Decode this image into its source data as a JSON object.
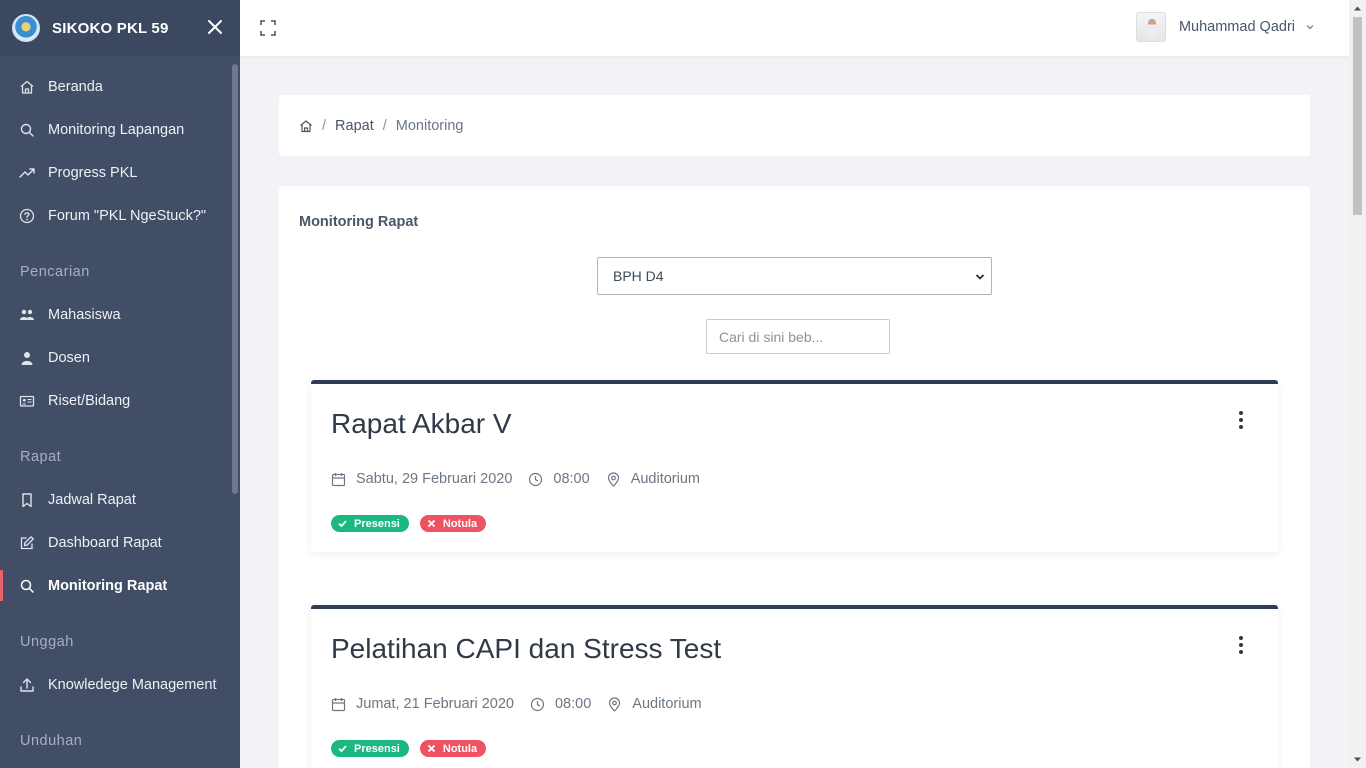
{
  "app": {
    "title": "SIKOKO PKL 59"
  },
  "sidebar": {
    "items": [
      {
        "label": "Beranda",
        "icon": "home-icon"
      },
      {
        "label": "Monitoring Lapangan",
        "icon": "search-icon"
      },
      {
        "label": "Progress PKL",
        "icon": "trending-up-icon"
      },
      {
        "label": "Forum \"PKL NgeStuck?\"",
        "icon": "help-circle-icon"
      }
    ],
    "section_pencarian": "Pencarian",
    "pencarian_items": [
      {
        "label": "Mahasiswa",
        "icon": "users-icon"
      },
      {
        "label": "Dosen",
        "icon": "user-icon"
      },
      {
        "label": "Riset/Bidang",
        "icon": "id-card-icon"
      }
    ],
    "section_rapat": "Rapat",
    "rapat_items": [
      {
        "label": "Jadwal Rapat",
        "icon": "bookmark-icon"
      },
      {
        "label": "Dashboard Rapat",
        "icon": "edit-icon"
      },
      {
        "label": "Monitoring Rapat",
        "icon": "search-icon",
        "active": true
      }
    ],
    "section_unggah": "Unggah",
    "unggah_items": [
      {
        "label": "Knowledege Management",
        "icon": "upload-icon"
      }
    ],
    "section_unduhan": "Unduhan"
  },
  "topbar": {
    "user_name": "Muhammad Qadri"
  },
  "breadcrumb": {
    "items": [
      "Rapat",
      "Monitoring"
    ],
    "separator": "/"
  },
  "main": {
    "title": "Monitoring Rapat",
    "select_value": "BPH D4",
    "search_placeholder": "Cari di sini beb..."
  },
  "events": [
    {
      "title": "Rapat Akbar V",
      "date": "Sabtu, 29 Februari 2020",
      "time": "08:00",
      "place": "Auditorium",
      "badge1": "Presensi",
      "badge2": "Notula"
    },
    {
      "title": "Pelatihan CAPI dan Stress Test",
      "date": "Jumat, 21 Februari 2020",
      "time": "08:00",
      "place": "Auditorium",
      "badge1": "Presensi",
      "badge2": "Notula"
    }
  ],
  "colors": {
    "sidebar": "#414e66",
    "accent_active": "#e9646a",
    "badge_green": "#1bb880",
    "badge_red": "#ef5363",
    "card_border": "#2f3d54"
  }
}
